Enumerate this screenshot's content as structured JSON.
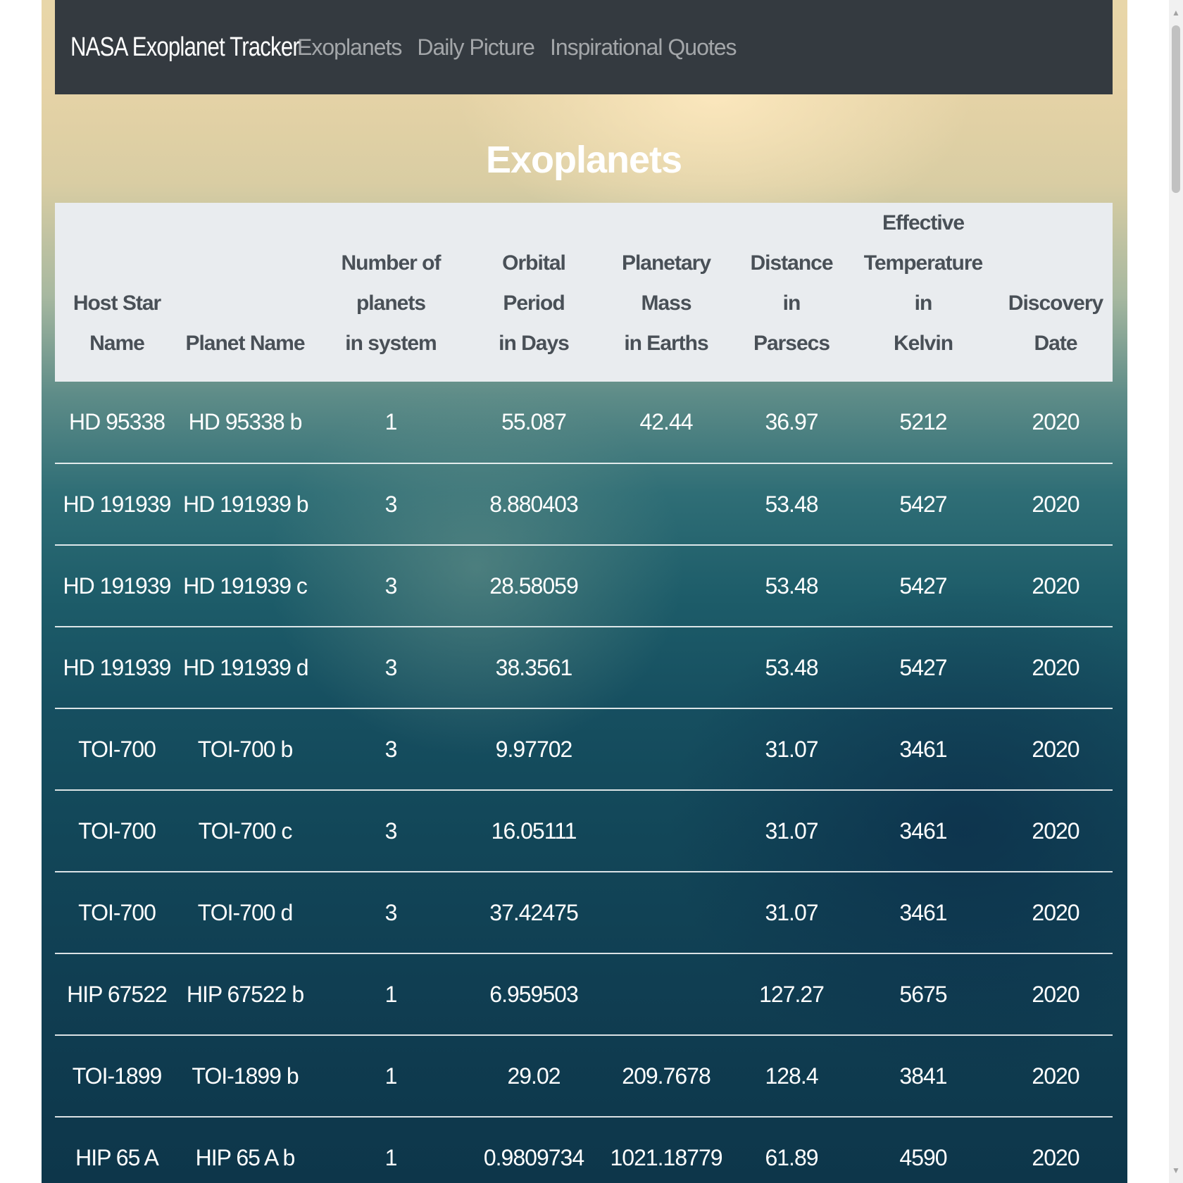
{
  "navbar": {
    "brand": "NASA Exoplanet Tracker",
    "links": [
      {
        "label": "Exoplanets"
      },
      {
        "label": "Daily Picture"
      },
      {
        "label": "Inspirational Quotes"
      }
    ]
  },
  "page": {
    "title": "Exoplanets"
  },
  "table": {
    "headers": [
      "Host Star Name",
      "Planet Name",
      "Number of planets in system",
      "Orbital Period in Days",
      "Planetary Mass in Earths",
      "Distance in Parsecs",
      "Effective Temperature in Kelvin",
      "Discovery Date"
    ],
    "rows": [
      [
        "HD 95338",
        "HD 95338 b",
        "1",
        "55.087",
        "42.44",
        "36.97",
        "5212",
        "2020"
      ],
      [
        "HD 191939",
        "HD 191939 b",
        "3",
        "8.880403",
        "",
        "53.48",
        "5427",
        "2020"
      ],
      [
        "HD 191939",
        "HD 191939 c",
        "3",
        "28.58059",
        "",
        "53.48",
        "5427",
        "2020"
      ],
      [
        "HD 191939",
        "HD 191939 d",
        "3",
        "38.3561",
        "",
        "53.48",
        "5427",
        "2020"
      ],
      [
        "TOI-700",
        "TOI-700 b",
        "3",
        "9.97702",
        "",
        "31.07",
        "3461",
        "2020"
      ],
      [
        "TOI-700",
        "TOI-700 c",
        "3",
        "16.05111",
        "",
        "31.07",
        "3461",
        "2020"
      ],
      [
        "TOI-700",
        "TOI-700 d",
        "3",
        "37.42475",
        "",
        "31.07",
        "3461",
        "2020"
      ],
      [
        "HIP 67522",
        "HIP 67522 b",
        "1",
        "6.959503",
        "",
        "127.27",
        "5675",
        "2020"
      ],
      [
        "TOI-1899",
        "TOI-1899 b",
        "1",
        "29.02",
        "209.7678",
        "128.4",
        "3841",
        "2020"
      ],
      [
        "HIP 65 A",
        "HIP 65 A b",
        "1",
        "0.9809734",
        "1021.18779",
        "61.89",
        "4590",
        "2020"
      ]
    ]
  },
  "scrollbar": {
    "up_arrow": "▲",
    "down_arrow": "▼"
  }
}
